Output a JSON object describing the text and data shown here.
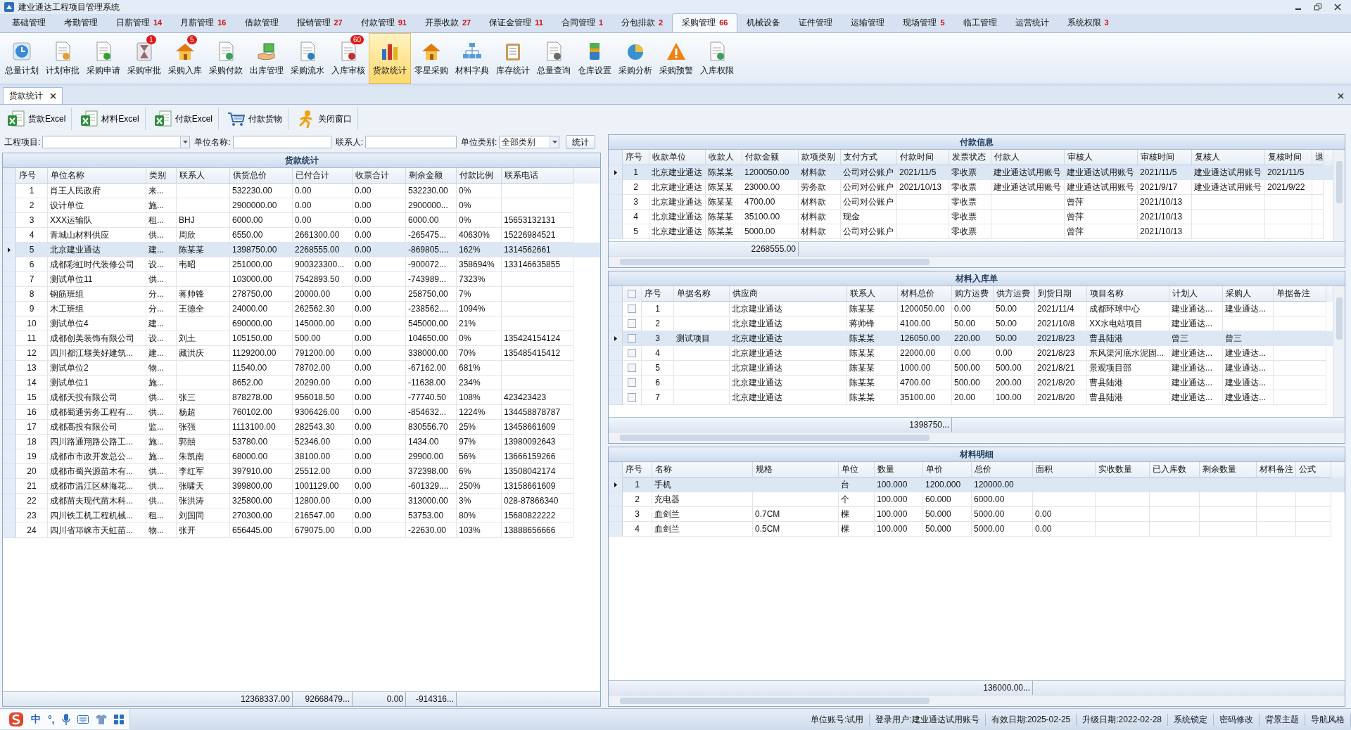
{
  "window": {
    "title": "建业通达工程项目管理系统"
  },
  "menu_tabs": [
    {
      "label": "基础管理",
      "selected": false
    },
    {
      "label": "考勤管理",
      "selected": false
    },
    {
      "label": "日薪管理",
      "count": "14",
      "selected": false
    },
    {
      "label": "月薪管理",
      "count": "16",
      "selected": false
    },
    {
      "label": "借款管理",
      "selected": false
    },
    {
      "label": "报销管理",
      "count": "27",
      "selected": false
    },
    {
      "label": "付款管理",
      "count": "91",
      "selected": false
    },
    {
      "label": "开票收款",
      "count": "27",
      "selected": false
    },
    {
      "label": "保证金管理",
      "count": "11",
      "selected": false
    },
    {
      "label": "合同管理",
      "count": "1",
      "selected": false
    },
    {
      "label": "分包排款",
      "count": "2",
      "selected": false
    },
    {
      "label": "采购管理",
      "count": "66",
      "selected": true
    },
    {
      "label": "机械设备",
      "selected": false
    },
    {
      "label": "证件管理",
      "selected": false
    },
    {
      "label": "运输管理",
      "selected": false
    },
    {
      "label": "现场管理",
      "count": "5",
      "selected": false
    },
    {
      "label": "临工管理",
      "selected": false
    },
    {
      "label": "运营统计",
      "selected": false
    },
    {
      "label": "系统权限",
      "count": "3",
      "selected": false
    }
  ],
  "toolbar": [
    {
      "label": "总量计划",
      "selected": false
    },
    {
      "label": "计划审批",
      "selected": false
    },
    {
      "label": "采购申请",
      "selected": false
    },
    {
      "label": "采购审批",
      "badge": "1",
      "selected": false
    },
    {
      "label": "采购入库",
      "badge": "5",
      "selected": false
    },
    {
      "label": "采购付款",
      "selected": false
    },
    {
      "label": "出库管理",
      "selected": false
    },
    {
      "label": "采购流水",
      "selected": false
    },
    {
      "label": "入库审核",
      "badge": "60",
      "selected": false
    },
    {
      "label": "货款统计",
      "selected": true
    },
    {
      "label": "零星采购",
      "selected": false
    },
    {
      "label": "材料字典",
      "selected": false
    },
    {
      "label": "库存统计",
      "selected": false
    },
    {
      "label": "总量查询",
      "selected": false
    },
    {
      "label": "仓库设置",
      "selected": false
    },
    {
      "label": "采购分析",
      "selected": false
    },
    {
      "label": "采购预警",
      "selected": false
    },
    {
      "label": "入库权限",
      "selected": false
    }
  ],
  "doc_tabs": [
    {
      "label": "货款统计",
      "selected": true
    }
  ],
  "actions": [
    "货款Excel",
    "材料Excel",
    "付款Excel",
    "付款货物",
    "关闭窗口"
  ],
  "filter": {
    "fields": [
      {
        "label": "工程项目:",
        "kind": "combo"
      },
      {
        "label": "单位名称:",
        "kind": "text"
      },
      {
        "label": "联系人:",
        "kind": "text"
      },
      {
        "label": "单位类别:",
        "kind": "select",
        "value": "全部类别"
      }
    ],
    "button": "统计"
  },
  "goods_table": {
    "title": "货款统计",
    "columns": [
      "序号",
      "单位名称",
      "类别",
      "联系人",
      "供货总价",
      "已付合计",
      "收票合计",
      "剩余金额",
      "付款比例",
      "联系电话"
    ],
    "rows": [
      {
        "selected": false,
        "no": "1",
        "unit": "肖王人民政府",
        "category": "来...",
        "supply_total": "532230.00",
        "paid_total": "0.00",
        "invoice_total": "0.00",
        "balance": "532230.00",
        "paid_ratio": "0%"
      },
      {
        "selected": false,
        "no": "2",
        "unit": "设计单位",
        "category": "施...",
        "supply_total": "2900000.00",
        "paid_total": "0.00",
        "invoice_total": "0.00",
        "balance": "2900000...",
        "paid_ratio": "0%"
      },
      {
        "selected": false,
        "no": "3",
        "unit": "XXX运输队",
        "category": "租...",
        "contact": "BHJ",
        "supply_total": "6000.00",
        "paid_total": "0.00",
        "invoice_total": "0.00",
        "balance": "6000.00",
        "paid_ratio": "0%",
        "phone": "15653132131"
      },
      {
        "selected": false,
        "no": "4",
        "unit": "青城山材料供应",
        "category": "供...",
        "contact": "周欣",
        "supply_total": "6550.00",
        "paid_total": "2661300.00",
        "invoice_total": "0.00",
        "balance": "-265475...",
        "paid_ratio": "40630%",
        "phone": "15226984521"
      },
      {
        "selected": true,
        "no": "5",
        "unit": "北京建业通达",
        "category": "建...",
        "contact": "陈某某",
        "supply_total": "1398750.00",
        "paid_total": "2268555.00",
        "invoice_total": "0.00",
        "balance": "-869805....",
        "paid_ratio": "162%",
        "phone": "1314562661"
      },
      {
        "selected": false,
        "no": "6",
        "unit": "成都彩虹时代装修公司",
        "category": "设...",
        "contact": "韦昭",
        "supply_total": "251000.00",
        "paid_total": "900323300...",
        "invoice_total": "0.00",
        "balance": "-900072...",
        "paid_ratio": "358694%",
        "phone": "133146635855"
      },
      {
        "selected": false,
        "no": "7",
        "unit": "测试单位11",
        "category": "供...",
        "supply_total": "103000.00",
        "paid_total": "7542893.50",
        "invoice_total": "0.00",
        "balance": "-743989...",
        "paid_ratio": "7323%"
      },
      {
        "selected": false,
        "no": "8",
        "unit": "钢筋班组",
        "category": "分...",
        "contact": "蒋帅锋",
        "supply_total": "278750.00",
        "paid_total": "20000.00",
        "invoice_total": "0.00",
        "balance": "258750.00",
        "paid_ratio": "7%"
      },
      {
        "selected": false,
        "no": "9",
        "unit": "木工班组",
        "category": "分...",
        "contact": "王德全",
        "supply_total": "24000.00",
        "paid_total": "262562.30",
        "invoice_total": "0.00",
        "balance": "-238562....",
        "paid_ratio": "1094%"
      },
      {
        "selected": false,
        "no": "10",
        "unit": "测试单位4",
        "category": "建...",
        "supply_total": "690000.00",
        "paid_total": "145000.00",
        "invoice_total": "0.00",
        "balance": "545000.00",
        "paid_ratio": "21%"
      },
      {
        "selected": false,
        "no": "11",
        "unit": "成都创美装饰有限公司",
        "category": "设...",
        "contact": "刘土",
        "supply_total": "105150.00",
        "paid_total": "500.00",
        "invoice_total": "0.00",
        "balance": "104650.00",
        "paid_ratio": "0%",
        "phone": "135424154124"
      },
      {
        "selected": false,
        "no": "12",
        "unit": "四川都江堰美好建筑...",
        "category": "建...",
        "contact": "藏洪庆",
        "supply_total": "1129200.00",
        "paid_total": "791200.00",
        "invoice_total": "0.00",
        "balance": "338000.00",
        "paid_ratio": "70%",
        "phone": "135485415412"
      },
      {
        "selected": false,
        "no": "13",
        "unit": "测试单位2",
        "category": "物...",
        "supply_total": "11540.00",
        "paid_total": "78702.00",
        "invoice_total": "0.00",
        "balance": "-67162.00",
        "paid_ratio": "681%"
      },
      {
        "selected": false,
        "no": "14",
        "unit": "测试单位1",
        "category": "施...",
        "supply_total": "8652.00",
        "paid_total": "20290.00",
        "invoice_total": "0.00",
        "balance": "-11638.00",
        "paid_ratio": "234%"
      },
      {
        "selected": false,
        "no": "15",
        "unit": "成都天投有限公司",
        "category": "供...",
        "contact": "张三",
        "supply_total": "878278.00",
        "paid_total": "956018.50",
        "invoice_total": "0.00",
        "balance": "-77740.50",
        "paid_ratio": "108%",
        "phone": "423423423"
      },
      {
        "selected": false,
        "no": "16",
        "unit": "成都蜀通劳务工程有...",
        "category": "供...",
        "contact": "杨超",
        "supply_total": "760102.00",
        "paid_total": "9306426.00",
        "invoice_total": "0.00",
        "balance": "-854632...",
        "paid_ratio": "1224%",
        "phone": "134458878787"
      },
      {
        "selected": false,
        "no": "17",
        "unit": "成都高投有限公司",
        "category": "监...",
        "contact": "张强",
        "supply_total": "1113100.00",
        "paid_total": "282543.30",
        "invoice_total": "0.00",
        "balance": "830556.70",
        "paid_ratio": "25%",
        "phone": "13458661609"
      },
      {
        "selected": false,
        "no": "18",
        "unit": "四川路通翔路公路工...",
        "category": "施...",
        "contact": "郭囍",
        "supply_total": "53780.00",
        "paid_total": "52346.00",
        "invoice_total": "0.00",
        "balance": "1434.00",
        "paid_ratio": "97%",
        "phone": "13980092643"
      },
      {
        "selected": false,
        "no": "19",
        "unit": "成都市市政开发总公...",
        "category": "施...",
        "contact": "朱凯南",
        "supply_total": "68000.00",
        "paid_total": "38100.00",
        "invoice_total": "0.00",
        "balance": "29900.00",
        "paid_ratio": "56%",
        "phone": "13666159266"
      },
      {
        "selected": false,
        "no": "20",
        "unit": "成都市蜀兴源苗木有...",
        "category": "供...",
        "contact": "李红军",
        "supply_total": "397910.00",
        "paid_total": "25512.00",
        "invoice_total": "0.00",
        "balance": "372398.00",
        "paid_ratio": "6%",
        "phone": "13508042174"
      },
      {
        "selected": false,
        "no": "21",
        "unit": "成都市温江区林海花...",
        "category": "供...",
        "contact": "张啸天",
        "supply_total": "399800.00",
        "paid_total": "1001129.00",
        "invoice_total": "0.00",
        "balance": "-601329....",
        "paid_ratio": "250%",
        "phone": "13158661609"
      },
      {
        "selected": false,
        "no": "22",
        "unit": "成都苗夫现代苗木科...",
        "category": "供...",
        "contact": "张洪涛",
        "supply_total": "325800.00",
        "paid_total": "12800.00",
        "invoice_total": "0.00",
        "balance": "313000.00",
        "paid_ratio": "3%",
        "phone": "028-87866340"
      },
      {
        "selected": false,
        "no": "23",
        "unit": "四川铁工机工程机械...",
        "category": "租...",
        "contact": "刘国同",
        "supply_total": "270300.00",
        "paid_total": "216547.00",
        "invoice_total": "0.00",
        "balance": "53753.00",
        "paid_ratio": "80%",
        "phone": "15680822222"
      },
      {
        "selected": false,
        "no": "24",
        "unit": "四川省邛崃市天虹苗...",
        "category": "物...",
        "contact": "张开",
        "supply_total": "656445.00",
        "paid_total": "679075.00",
        "invoice_total": "0.00",
        "balance": "-22630.00",
        "paid_ratio": "103%",
        "phone": "13888656666"
      }
    ],
    "footer": {
      "supply_total": "12368337.00",
      "paid_total": "92668479...",
      "invoice_total": "0.00",
      "balance": "-914316..."
    }
  },
  "payment_table": {
    "title": "付款信息",
    "columns": [
      "序号",
      "收款单位",
      "收款人",
      "付款金额",
      "款项类别",
      "支付方式",
      "付款时间",
      "发票状态",
      "付款人",
      "审核人",
      "审核时间",
      "复核人",
      "复核时间",
      "退"
    ],
    "rows": [
      {
        "selected": true,
        "no": "1",
        "payee_unit": "北京建业通达",
        "payee": "陈某某",
        "amount": "1200050.00",
        "fund_type": "材料款",
        "method": "公司对公账户",
        "pay_date": "2021/11/5",
        "invoice_status": "零收票",
        "payer": "建业通达试用账号",
        "reviewer": "建业通达试用账号",
        "review_date": "2021/11/5",
        "rechecker": "建业通达试用账号",
        "recheck_date": "2021/11/5"
      },
      {
        "selected": false,
        "no": "2",
        "payee_unit": "北京建业通达",
        "payee": "陈某某",
        "amount": "23000.00",
        "fund_type": "劳务款",
        "method": "公司对公账户",
        "pay_date": "2021/10/13",
        "invoice_status": "零收票",
        "payer": "建业通达试用账号",
        "reviewer": "建业通达试用账号",
        "review_date": "2021/9/17",
        "rechecker": "建业通达试用账号",
        "recheck_date": "2021/9/22"
      },
      {
        "selected": false,
        "no": "3",
        "payee_unit": "北京建业通达",
        "payee": "陈某某",
        "amount": "4700.00",
        "fund_type": "材料款",
        "method": "公司对公账户",
        "invoice_status": "零收票",
        "reviewer": "曾萍",
        "review_date": "2021/10/13"
      },
      {
        "selected": false,
        "no": "4",
        "payee_unit": "北京建业通达",
        "payee": "陈某某",
        "amount": "35100.00",
        "fund_type": "材料款",
        "method": "现金",
        "invoice_status": "零收票",
        "reviewer": "曾萍",
        "review_date": "2021/10/13"
      },
      {
        "selected": false,
        "no": "5",
        "payee_unit": "北京建业通达",
        "payee": "陈某某",
        "amount": "5000.00",
        "fund_type": "材料款",
        "method": "公司对公账户",
        "invoice_status": "零收票",
        "reviewer": "曾萍",
        "review_date": "2021/10/13"
      }
    ],
    "footer": {
      "amount": "2268555.00"
    }
  },
  "inbound_table": {
    "title": "材料入库单",
    "header_checked": false,
    "columns": [
      "序号",
      "单据名称",
      "供应商",
      "联系人",
      "材料总价",
      "购方运费",
      "供方运费",
      "到货日期",
      "项目名称",
      "计划人",
      "采购人",
      "单据备注"
    ],
    "rows": [
      {
        "selected": false,
        "checked": false,
        "no": "1",
        "supplier": "北京建业通达",
        "contact": "陈某某",
        "material_total": "1200050.00",
        "buyer_freight": "0.00",
        "supplier_freight": "50.00",
        "arrival_date": "2021/11/4",
        "project": "成都环球中心",
        "planner": "建业通达...",
        "purchaser": "建业通达..."
      },
      {
        "selected": false,
        "checked": false,
        "no": "2",
        "supplier": "北京建业通达",
        "contact": "蒋帅锋",
        "material_total": "4100.00",
        "buyer_freight": "50.00",
        "supplier_freight": "50.00",
        "arrival_date": "2021/10/8",
        "project": "XX水电站项目",
        "planner": "建业通达..."
      },
      {
        "selected": true,
        "checked": false,
        "no": "3",
        "doc_name": "测试项目",
        "supplier": "北京建业通达",
        "contact": "陈某某",
        "material_total": "126050.00",
        "buyer_freight": "220.00",
        "supplier_freight": "50.00",
        "arrival_date": "2021/8/23",
        "project": "曹县陆港",
        "planner": "曾三",
        "purchaser": "曾三"
      },
      {
        "selected": false,
        "checked": false,
        "no": "4",
        "supplier": "北京建业通达",
        "contact": "陈某某",
        "material_total": "22000.00",
        "buyer_freight": "0.00",
        "supplier_freight": "0.00",
        "arrival_date": "2021/8/23",
        "project": "东风渠河底水泥固...",
        "planner": "建业通达...",
        "purchaser": "建业通达..."
      },
      {
        "selected": false,
        "checked": false,
        "no": "5",
        "supplier": "北京建业通达",
        "contact": "陈某某",
        "material_total": "1000.00",
        "buyer_freight": "500.00",
        "supplier_freight": "500.00",
        "arrival_date": "2021/8/21",
        "project": "景观项目部",
        "planner": "建业通达...",
        "purchaser": "建业通达..."
      },
      {
        "selected": false,
        "checked": false,
        "no": "6",
        "supplier": "北京建业通达",
        "contact": "陈某某",
        "material_total": "4700.00",
        "buyer_freight": "500.00",
        "supplier_freight": "200.00",
        "arrival_date": "2021/8/20",
        "project": "曹县陆港",
        "planner": "建业通达...",
        "purchaser": "建业通达..."
      },
      {
        "selected": false,
        "checked": false,
        "no": "7",
        "supplier": "北京建业通达",
        "contact": "陈某某",
        "material_total": "35100.00",
        "buyer_freight": "20.00",
        "supplier_freight": "100.00",
        "arrival_date": "2021/8/20",
        "project": "曹县陆港",
        "planner": "建业通达...",
        "purchaser": "建业通达..."
      }
    ],
    "footer": {
      "material_total": "1398750..."
    }
  },
  "detail_table": {
    "title": "材料明细",
    "columns": [
      "序号",
      "名称",
      "规格",
      "单位",
      "数量",
      "单价",
      "总价",
      "面积",
      "实收数量",
      "已入库数",
      "剩余数量",
      "材料备注",
      "公式"
    ],
    "rows": [
      {
        "selected": true,
        "no": "1",
        "name": "手机",
        "unit": "台",
        "qty": "100.000",
        "price": "1200.000",
        "total": "120000.00"
      },
      {
        "selected": false,
        "no": "2",
        "name": "充电器",
        "unit": "个",
        "qty": "100.000",
        "price": "60.000",
        "total": "6000.00"
      },
      {
        "selected": false,
        "no": "3",
        "name": "血剑兰",
        "spec": "0.7CM",
        "unit": "棵",
        "qty": "100.000",
        "price": "50.000",
        "total": "5000.00",
        "area": "0.00"
      },
      {
        "selected": false,
        "no": "4",
        "name": "血剑兰",
        "spec": "0.5CM",
        "unit": "棵",
        "qty": "100.000",
        "price": "50.000",
        "total": "5000.00",
        "area": "0.00"
      }
    ],
    "footer": {
      "total": "136000.00..."
    }
  },
  "ime": [
    "中",
    "°,"
  ],
  "status_info": [
    "单位账号:试用",
    "登录用户:建业通达试用账号",
    "有效日期:2025-02-25",
    "升级日期:2022-02-28"
  ],
  "status_actions": [
    "系统锁定",
    "密码修改",
    "背景主题",
    "导航风格"
  ]
}
